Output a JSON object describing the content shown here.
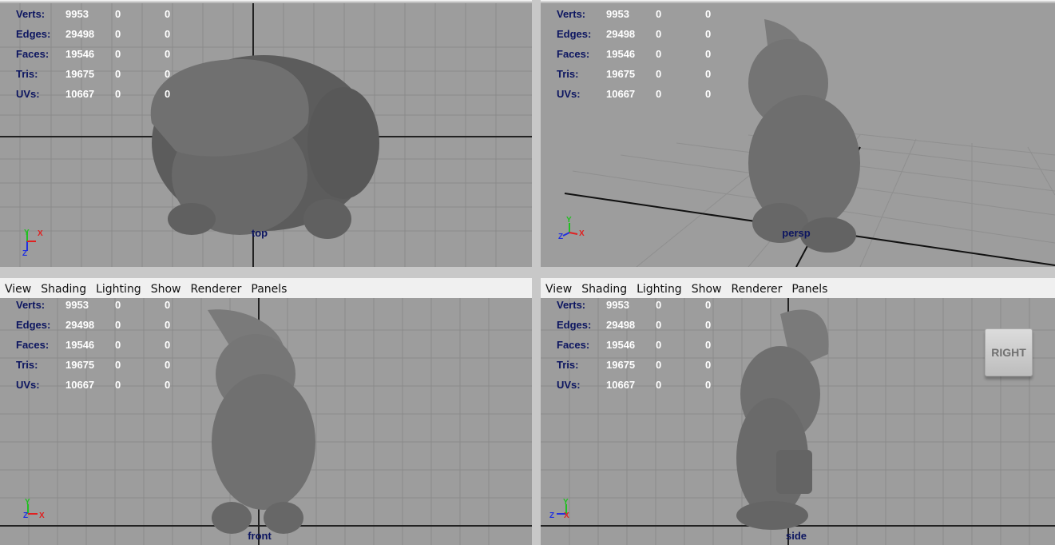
{
  "menu": [
    "View",
    "Shading",
    "Lighting",
    "Show",
    "Renderer",
    "Panels"
  ],
  "hud": {
    "rows": [
      {
        "label": "Verts:",
        "values": [
          "9953",
          "0",
          "0"
        ]
      },
      {
        "label": "Edges:",
        "values": [
          "29498",
          "0",
          "0"
        ]
      },
      {
        "label": "Faces:",
        "values": [
          "19546",
          "0",
          "0"
        ]
      },
      {
        "label": "Tris:",
        "values": [
          "19675",
          "0",
          "0"
        ]
      },
      {
        "label": "UVs:",
        "values": [
          "10667",
          "0",
          "0"
        ]
      }
    ]
  },
  "viewports": {
    "top": {
      "camera": "top"
    },
    "persp": {
      "camera": "persp"
    },
    "front": {
      "camera": "front"
    },
    "side": {
      "camera": "side",
      "viewcube": "RIGHT"
    }
  },
  "axes": {
    "x": "X",
    "y": "Y",
    "z": "Z"
  },
  "colors": {
    "viewport_bg": "#9d9d9d",
    "grid": "#8a8a8a",
    "hud_label": "#0c1560",
    "hud_value": "#ffffff",
    "axis_x": "#e02020",
    "axis_y": "#20c020",
    "axis_z": "#2030e0",
    "menubar": "#f0f0f0"
  }
}
